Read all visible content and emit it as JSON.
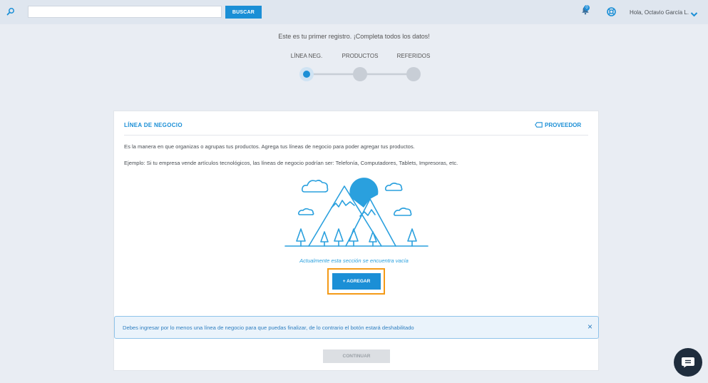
{
  "topbar": {
    "search_placeholder": "",
    "search_button": "BUSCAR",
    "notification_count": "0",
    "user_greeting": "Hola, Octavio García L."
  },
  "stepper": {
    "intro": "Este es tu primer registro. ¡Completa todos los datos!",
    "steps": [
      {
        "label": "LÍNEA NEG.",
        "active": true
      },
      {
        "label": "PRODUCTOS",
        "active": false
      },
      {
        "label": "REFERIDOS",
        "active": false
      }
    ]
  },
  "card": {
    "title": "LÍNEA DE NEGOCIO",
    "proveedor_link": "PROVEEDOR",
    "description": "Es la manera en que organizas o agrupas tus productos. Agrega tus líneas de negocio para poder agregar tus productos.",
    "example": "Ejemplo: Si tu empresa vende artículos tecnológicos, las líneas de negocio podrían ser: Telefonía, Computadores, Tablets, Impresoras, etc.",
    "empty_message": "Actualmente esta sección se encuentra vacía",
    "add_button": "+  AGREGAR"
  },
  "alert": {
    "message": "Debes ingresar por lo menos una línea de negocio para que puedas finalizar, de lo contrario el botón estará deshabilitado",
    "close": "×"
  },
  "footer": {
    "continue_button": "CONTINUAR"
  },
  "colors": {
    "accent": "#1b8fd6",
    "highlight": "#f49a17",
    "disabled": "#dcdfe3"
  }
}
